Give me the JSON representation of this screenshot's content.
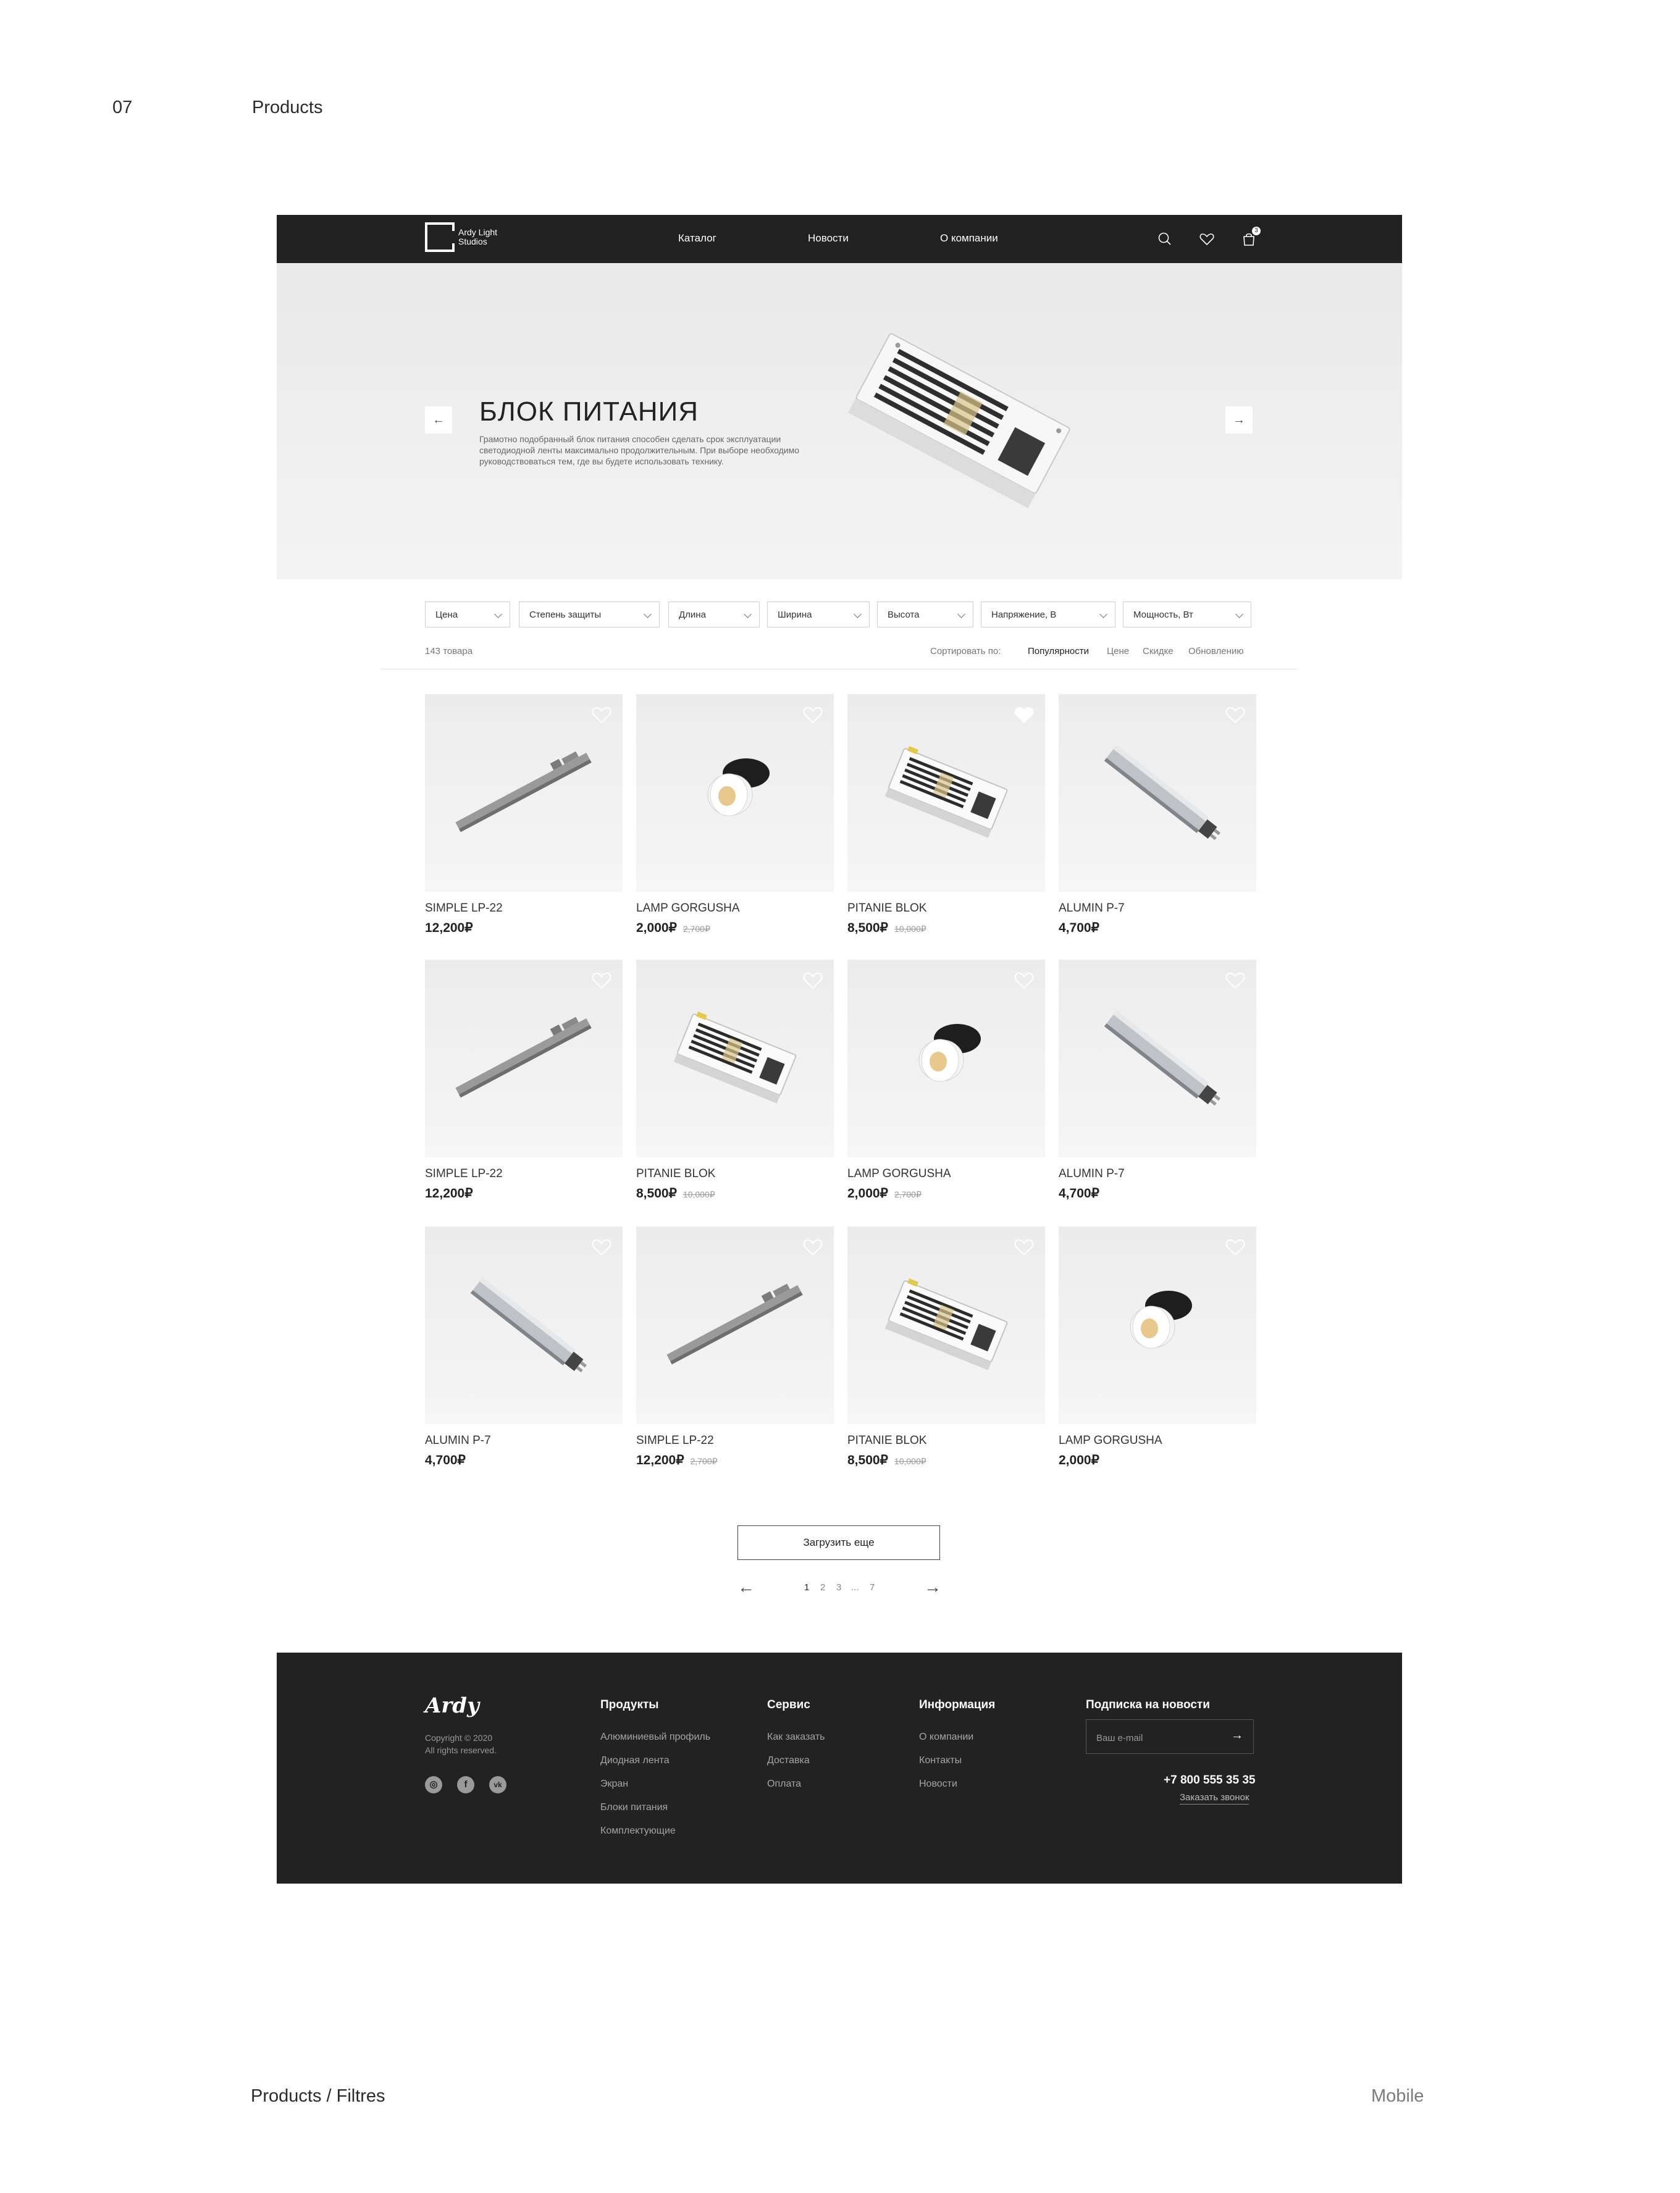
{
  "page": {
    "number": "07",
    "section": "Products",
    "caption": "Products / Filtres",
    "mode": "Mobile"
  },
  "header": {
    "logo_text": "Ardy Light Studios",
    "nav": [
      "Каталог",
      "Новости",
      "О компании"
    ],
    "cart_count": "3"
  },
  "hero": {
    "title": "БЛОК ПИТАНИЯ",
    "text": "Грамотно подобранный блок питания способен сделать срок эксплуатации светодиодной ленты максимально продолжительным. При выборе необходимо руководствоваться тем, где вы будете использовать технику."
  },
  "filters": [
    "Цена",
    "Степень защиты",
    "Длина",
    "Ширина",
    "Высота",
    "Напряжение, В",
    "Мощность, Вт"
  ],
  "results": {
    "count": "143 товара",
    "sort_label": "Сортировать по:",
    "sort_options": [
      "Популярности",
      "Цене",
      "Скидке",
      "Обновлению"
    ]
  },
  "products": [
    {
      "name": "SIMPLE LP-22",
      "price": "12,200₽",
      "old_price": "",
      "type": "profile",
      "fav": false
    },
    {
      "name": "LAMP GORGUSHA",
      "price": "2,000₽",
      "old_price": "2,700₽",
      "type": "lamp",
      "fav": false
    },
    {
      "name": "PITANIE BLOK",
      "price": "8,500₽",
      "old_price": "10,000₽",
      "type": "psu",
      "fav": true
    },
    {
      "name": "ALUMIN P-7",
      "price": "4,700₽",
      "old_price": "",
      "type": "alumin",
      "fav": false
    },
    {
      "name": "SIMPLE LP-22",
      "price": "12,200₽",
      "old_price": "",
      "type": "profile",
      "fav": false
    },
    {
      "name": "PITANIE BLOK",
      "price": "8,500₽",
      "old_price": "10,000₽",
      "type": "psu",
      "fav": false
    },
    {
      "name": "LAMP GORGUSHA",
      "price": "2,000₽",
      "old_price": "2,700₽",
      "type": "lamp",
      "fav": false
    },
    {
      "name": "ALUMIN P-7",
      "price": "4,700₽",
      "old_price": "",
      "type": "alumin",
      "fav": false
    },
    {
      "name": "ALUMIN P-7",
      "price": "4,700₽",
      "old_price": "",
      "type": "alumin",
      "fav": false
    },
    {
      "name": "SIMPLE LP-22",
      "price": "12,200₽",
      "old_price": "2,700₽",
      "type": "profile",
      "fav": false
    },
    {
      "name": "PITANIE BLOK",
      "price": "8,500₽",
      "old_price": "10,000₽",
      "type": "psu",
      "fav": false
    },
    {
      "name": "LAMP GORGUSHA",
      "price": "2,000₽",
      "old_price": "",
      "type": "lamp",
      "fav": false
    }
  ],
  "load_more": "Загрузить еще",
  "pagination": {
    "pages": [
      "1",
      "2",
      "3",
      "...",
      "7"
    ],
    "current": "1"
  },
  "footer": {
    "logo": "Ardy",
    "copyright": "Copyright © 2020",
    "rights": "All rights reserved.",
    "columns": [
      {
        "title": "Продукты",
        "links": [
          "Алюминиевый профиль",
          "Диодная лента",
          "Экран",
          "Блоки питания",
          "Комплектующие"
        ]
      },
      {
        "title": "Сервис",
        "links": [
          "Как заказать",
          "Доставка",
          "Оплата"
        ]
      },
      {
        "title": "Информация",
        "links": [
          "О компании",
          "Контакты",
          "Новости"
        ]
      }
    ],
    "newsletter": {
      "title": "Подписка на новости",
      "placeholder": "Ваш e-mail"
    },
    "phone": "+7 800 555 35 35",
    "callback": "Заказать звонок"
  }
}
